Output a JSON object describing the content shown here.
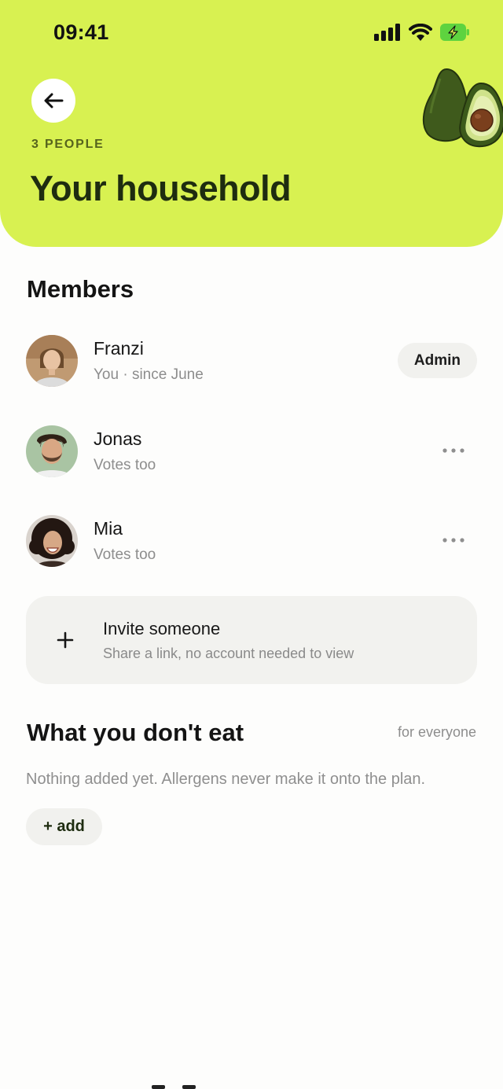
{
  "status_bar": {
    "time": "09:41",
    "icons": [
      "signal-icon",
      "wifi-icon",
      "battery-charging-icon"
    ]
  },
  "header": {
    "back_icon": "arrow-left-icon",
    "people_count": "3 PEOPLE",
    "title": "Your household",
    "illustration": "avocado-illustration"
  },
  "members_section": {
    "title": "Members",
    "members": [
      {
        "name": "Franzi",
        "subtitle": "You · since June",
        "badge": "Admin"
      },
      {
        "name": "Jonas",
        "subtitle": "Votes too",
        "action_icon": "more-horizontal-icon"
      },
      {
        "name": "Mia",
        "subtitle": "Votes too",
        "action_icon": "more-horizontal-icon"
      }
    ]
  },
  "invite": {
    "icon": "plus-icon",
    "title": "Invite someone",
    "subtitle": "Share a link, no account needed to view"
  },
  "diet_section": {
    "title": "What you don't eat",
    "scope": "for everyone",
    "empty_note": "Nothing added yet. Allergens never make it onto the plan.",
    "add_label": "+ add"
  },
  "colors": {
    "header_bg": "#d8f151",
    "title_color": "#1e2c10",
    "card_bg": "#f2f2ef",
    "muted_text": "#8d8d8d",
    "battery_green": "#5ed33f"
  }
}
